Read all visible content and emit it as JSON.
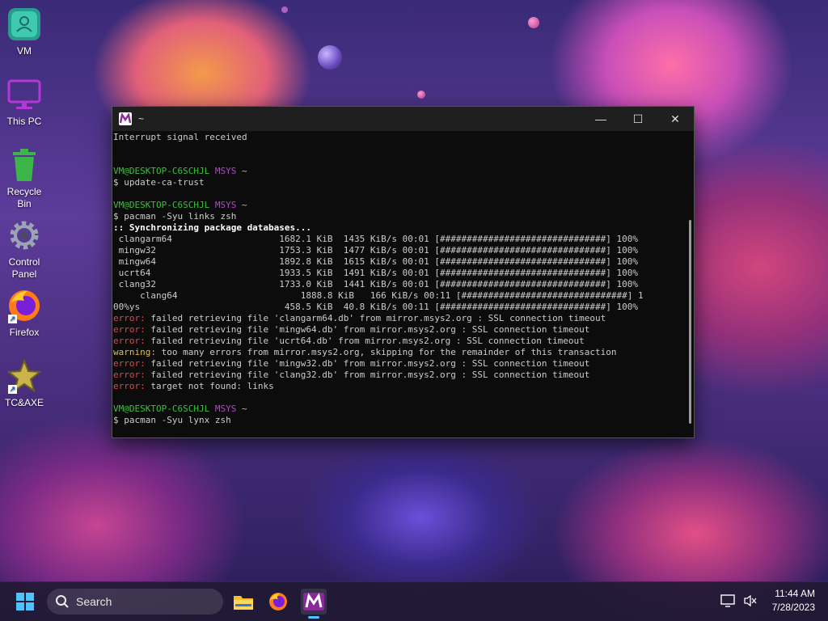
{
  "desktop": {
    "icons": [
      {
        "label": "VM"
      },
      {
        "label": "This PC"
      },
      {
        "label": "Recycle Bin"
      },
      {
        "label": "Control Panel"
      },
      {
        "label": "Firefox"
      },
      {
        "label": "TC&AXE"
      }
    ]
  },
  "window": {
    "title": "~",
    "controls": {
      "minimize": "—",
      "maximize": "☐",
      "close": "✕"
    }
  },
  "terminal": {
    "lines": [
      [
        {
          "t": "Interrupt signal received",
          "c": ""
        }
      ],
      [
        {
          "t": "",
          "c": ""
        }
      ],
      [
        {
          "t": "",
          "c": ""
        }
      ],
      [
        {
          "t": "VM@DESKTOP-C6SCHJL",
          "c": "c-green"
        },
        {
          "t": " MSYS",
          "c": "c-purple"
        },
        {
          "t": " ~",
          "c": "c-yellow"
        }
      ],
      [
        {
          "t": "$ update-ca-trust",
          "c": ""
        }
      ],
      [
        {
          "t": "",
          "c": ""
        }
      ],
      [
        {
          "t": "VM@DESKTOP-C6SCHJL",
          "c": "c-green"
        },
        {
          "t": " MSYS",
          "c": "c-purple"
        },
        {
          "t": " ~",
          "c": "c-yellow"
        }
      ],
      [
        {
          "t": "$ pacman -Syu links zsh",
          "c": ""
        }
      ],
      [
        {
          "t": ":: Synchronizing package databases...",
          "c": "c-bold"
        }
      ],
      [
        {
          "t": " clangarm64                    1682.1 KiB  1435 KiB/s 00:01 [###############################] 100%",
          "c": ""
        }
      ],
      [
        {
          "t": " mingw32                       1753.3 KiB  1477 KiB/s 00:01 [###############################] 100%",
          "c": ""
        }
      ],
      [
        {
          "t": " mingw64                       1892.8 KiB  1615 KiB/s 00:01 [###############################] 100%",
          "c": ""
        }
      ],
      [
        {
          "t": " ucrt64                        1933.5 KiB  1491 KiB/s 00:01 [###############################] 100%",
          "c": ""
        }
      ],
      [
        {
          "t": " clang32                       1733.0 KiB  1441 KiB/s 00:01 [###############################] 100%",
          "c": ""
        }
      ],
      [
        {
          "t": "     clang64                       1888.8 KiB   166 KiB/s 00:11 [###############################] 1",
          "c": ""
        }
      ],
      [
        {
          "t": "00%ys                           458.5 KiB  40.8 KiB/s 00:11 [###############################] 100%",
          "c": ""
        }
      ],
      [
        {
          "t": "error:",
          "c": "c-red"
        },
        {
          "t": " failed retrieving file 'clangarm64.db' from mirror.msys2.org : SSL connection timeout",
          "c": ""
        }
      ],
      [
        {
          "t": "error:",
          "c": "c-red"
        },
        {
          "t": " failed retrieving file 'mingw64.db' from mirror.msys2.org : SSL connection timeout",
          "c": ""
        }
      ],
      [
        {
          "t": "error:",
          "c": "c-red"
        },
        {
          "t": " failed retrieving file 'ucrt64.db' from mirror.msys2.org : SSL connection timeout",
          "c": ""
        }
      ],
      [
        {
          "t": "warning:",
          "c": "c-yellow"
        },
        {
          "t": " too many errors from mirror.msys2.org, skipping for the remainder of this transaction",
          "c": ""
        }
      ],
      [
        {
          "t": "error:",
          "c": "c-red"
        },
        {
          "t": " failed retrieving file 'mingw32.db' from mirror.msys2.org : SSL connection timeout",
          "c": ""
        }
      ],
      [
        {
          "t": "error:",
          "c": "c-red"
        },
        {
          "t": " failed retrieving file 'clang32.db' from mirror.msys2.org : SSL connection timeout",
          "c": ""
        }
      ],
      [
        {
          "t": "error:",
          "c": "c-red"
        },
        {
          "t": " target not found: links",
          "c": ""
        }
      ],
      [
        {
          "t": "",
          "c": ""
        }
      ],
      [
        {
          "t": "VM@DESKTOP-C6SCHJL",
          "c": "c-green"
        },
        {
          "t": " MSYS",
          "c": "c-purple"
        },
        {
          "t": " ~",
          "c": "c-yellow"
        }
      ],
      [
        {
          "t": "$ pacman -Syu lynx zsh",
          "c": ""
        }
      ]
    ]
  },
  "taskbar": {
    "search_placeholder": "Search",
    "time": "11:44 AM",
    "date": "7/28/2023"
  },
  "colors": {
    "prompt_user": "#3fbf3f",
    "prompt_host": "#b048c8",
    "error": "#e04848",
    "warning": "#e0c048",
    "accent": "#4cc2ff"
  }
}
